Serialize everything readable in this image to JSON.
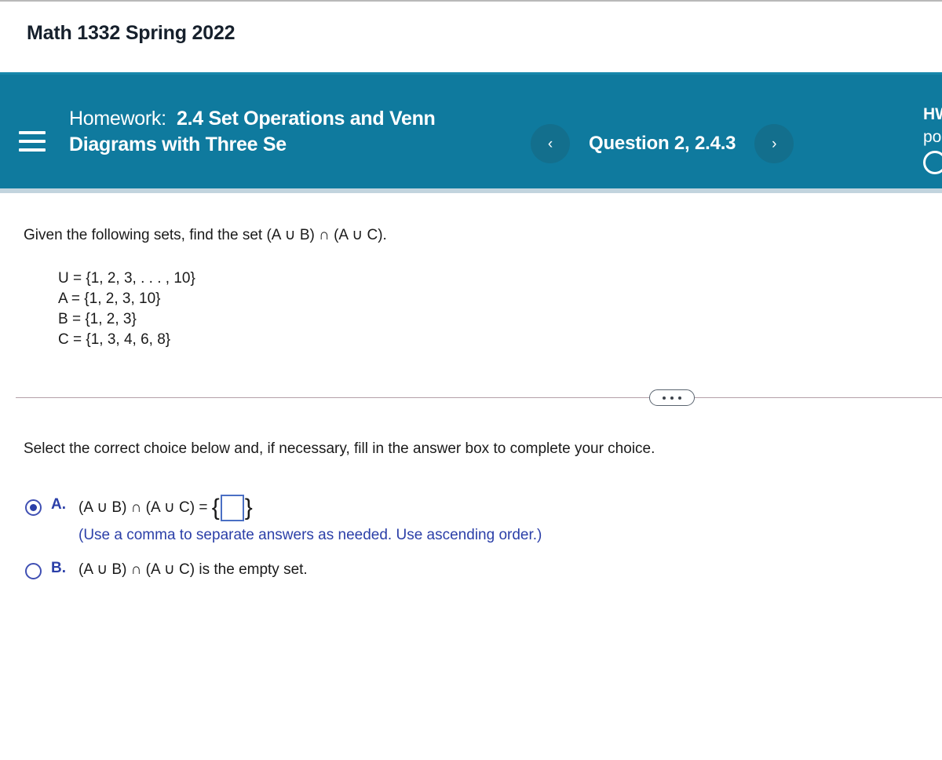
{
  "course": {
    "title": "Math 1332 Spring 2022"
  },
  "header": {
    "menu_icon": "hamburger-icon",
    "assignment_label": "Homework:",
    "assignment_name": "2.4 Set Operations and Venn Diagrams with Three Se",
    "prev_icon": "‹",
    "next_icon": "›",
    "question_label": "Question 2, 2.4.3",
    "hw_score_label": "HW",
    "points_label": "po",
    "progress_icon": "progress-ring-icon",
    "accent_color": "#0f7a9e"
  },
  "problem": {
    "prompt": "Given the following sets, find the set (A ∪ B) ∩ (A ∪ C).",
    "sets": [
      "U = {1, 2, 3, . . . , 10}",
      "A = {1, 2, 3, 10}",
      "B = {1, 2, 3}",
      "C = {1, 3, 4, 6, 8}"
    ],
    "divider_dots": "•••"
  },
  "answer": {
    "instruction": "Select the correct choice below and, if necessary, fill in the answer box to complete your choice.",
    "choices": [
      {
        "letter": "A.",
        "expression": "(A ∪ B) ∩ (A ∪ C) =",
        "open_brace": "{",
        "close_brace": "}",
        "input_value": "",
        "input_placeholder": "",
        "hint": "(Use a comma to separate answers as needed. Use ascending order.)",
        "selected": true
      },
      {
        "letter": "B.",
        "text": "(A ∪ B) ∩ (A ∪ C) is the empty set.",
        "selected": false
      }
    ],
    "selected_color": "#2b3fa8"
  }
}
